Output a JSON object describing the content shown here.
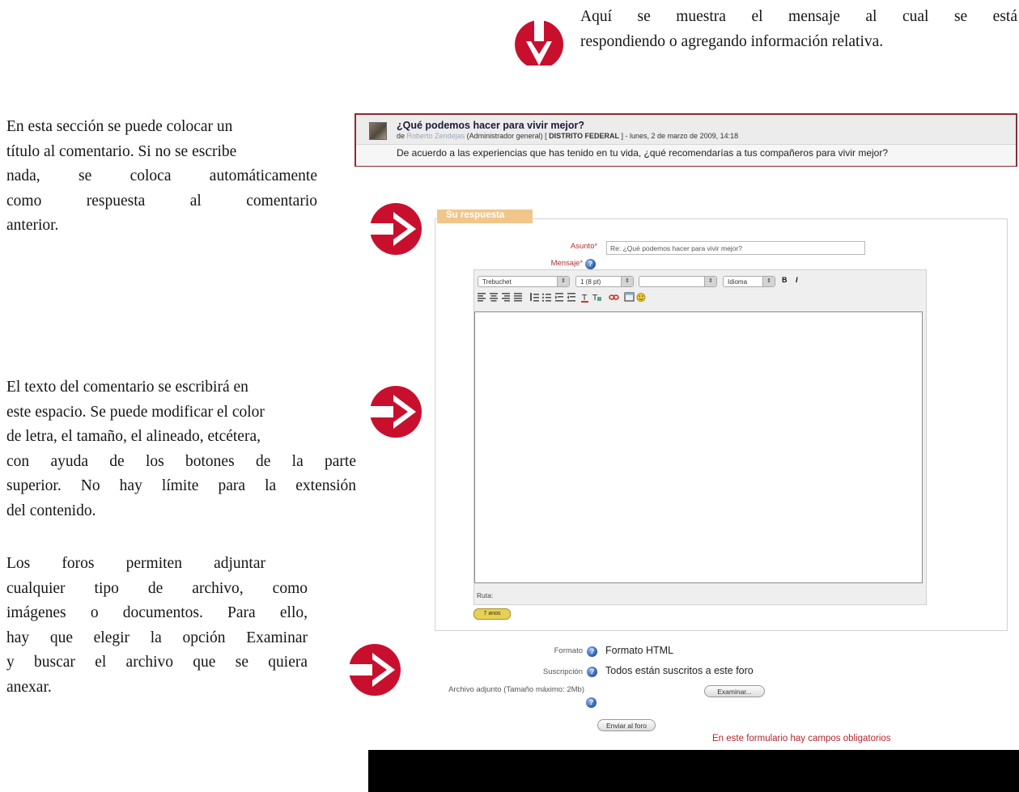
{
  "annotations": {
    "top": [
      "Aquí se muestra el mensaje al cual se está",
      "respondiendo o agregando información relativa."
    ],
    "title_section": [
      "En esta sección se puede colocar un",
      "título al comentario. Si no se escribe",
      "nada, se coloca automáticamente",
      "como respuesta al comentario",
      "anterior."
    ],
    "text_section": [
      "El texto del comentario se escribirá en",
      "este espacio. Se puede modificar el color",
      "de letra, el tamaño, el alineado, etcétera,",
      "con ayuda de los botones de la parte",
      "superior. No hay límite para la extensión",
      "del contenido."
    ],
    "attach_section": [
      "Los foros permiten adjuntar",
      "cualquier tipo de archivo, como",
      "imágenes o documentos. Para ello,",
      "hay que elegir la opción Examinar",
      "y buscar el archivo que se quiera",
      "anexar."
    ]
  },
  "post": {
    "title": "¿Qué podemos hacer para vivir mejor?",
    "meta_prefix": "de",
    "author": "Roberto Zendejas",
    "role": "(Administrador general) [",
    "location": "DISTRITO FEDERAL",
    "date": "] - lunes, 2 de marzo de 2009, 14:18",
    "body": "De acuerdo a las experiencias que has tenido en tu vida, ¿qué recomendarías a tus compañeros para vivir mejor?"
  },
  "form": {
    "legend": "Su respuesta",
    "subject_label": "Asunto",
    "required_mark": "*",
    "subject_value": "Re: ¿Qué podemos hacer para vivir mejor?",
    "message_label": "Mensaje",
    "editor": {
      "font_select": "Trebuchet",
      "size_select": "1 (8 pt)",
      "format_select": "",
      "language_select": "Idioma",
      "bold": "B",
      "italic": "I",
      "path_label": "Ruta:",
      "badge": "7 anos"
    },
    "format_label": "Formato",
    "format_value": "Formato HTML",
    "subscription_label": "Suscripción",
    "subscription_value": "Todos están suscritos a este foro",
    "attachment_label": "Archivo adjunto (Tamaño máximo: 2Mb)",
    "browse_button": "Examinar...",
    "submit_button": "Enviar al foro",
    "required_note": "En este formulario hay campos obligatorios"
  },
  "colors": {
    "arrow_red": "#c8102e",
    "post_border": "#8b2b33",
    "legend_orange": "#f1c68a",
    "required_red": "#b0262f"
  }
}
